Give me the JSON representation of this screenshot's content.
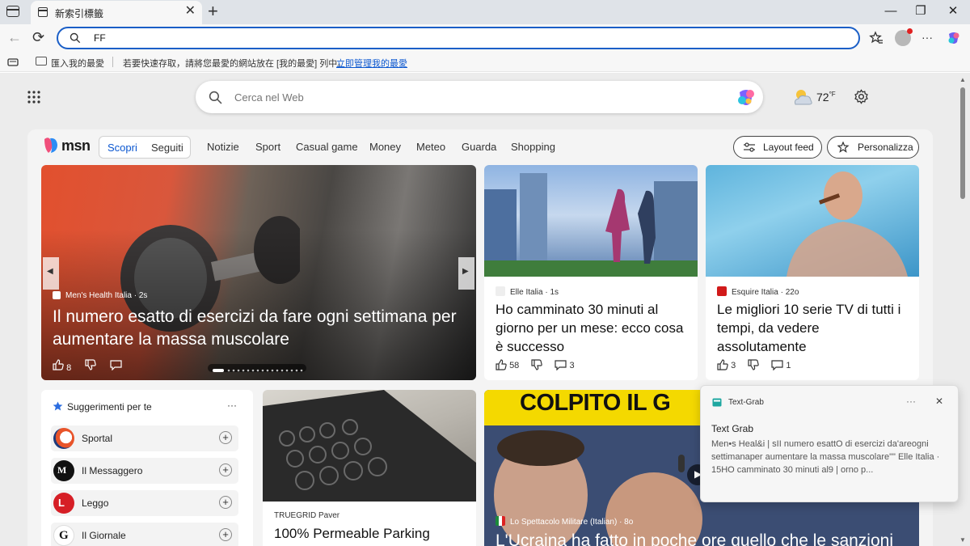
{
  "tab": {
    "title": "新索引標籤",
    "close": "✕",
    "new_tab": "+"
  },
  "window": {
    "minimize": "—",
    "maximize": "❐",
    "close": "✕"
  },
  "toolbar": {
    "back": "←",
    "reload": "⟳",
    "address_value": "FF",
    "more": "···"
  },
  "favorites_bar": {
    "import_label": "匯入我的最愛",
    "hint": "若要快速存取，請將您最愛的網站放在 [我的最愛] 列中。",
    "manage_link": "立即管理我的最愛"
  },
  "ntp": {
    "search_placeholder": "Cerca nel Web",
    "weather_temp": "72",
    "weather_unit": "°F"
  },
  "msn": {
    "logo": "msn",
    "segments": [
      "Scopri",
      "Seguiti"
    ],
    "nav": [
      "Notizie",
      "Sport",
      "Casual game",
      "Money",
      "Meteo",
      "Guarda",
      "Shopping"
    ],
    "layout_feed": "Layout feed",
    "personalize": "Personalizza"
  },
  "hero": {
    "source": "Men's Health Italia · 2s",
    "title": "Il numero esatto di esercizi da fare ogni settimana per aumentare la massa muscolare",
    "likes": "8"
  },
  "cards": [
    {
      "source": "Elle Italia · 1s",
      "title": "Ho camminato 30 minuti al giorno per un mese: ecco cosa è successo",
      "likes": "58",
      "comments": "3"
    },
    {
      "source": "Esquire Italia · 22o",
      "title": "Le migliori 10 serie TV di tutti i tempi, da vedere assolutamente",
      "likes": "3",
      "comments": "1"
    }
  ],
  "suggestions": {
    "title": "Suggerimenti per te",
    "more": "···",
    "items": [
      {
        "name": "Sportal",
        "add": "+"
      },
      {
        "name": "Il Messaggero",
        "add": "+"
      },
      {
        "name": "Leggo",
        "add": "+"
      },
      {
        "name": "Il Giornale",
        "add": "+"
      }
    ]
  },
  "card_paver": {
    "source": "TRUEGRID Paver",
    "title": "100% Permeable Parking"
  },
  "card_news": {
    "banner": "COLPITO IL G",
    "source": "Lo Spettacolo Militare (Italian) · 8o",
    "title": "L'Ucraina ha fatto in poche ore quello che le sanzioni"
  },
  "text_grab": {
    "app": "Text-Grab",
    "more": "···",
    "close": "✕",
    "heading": "Text Grab",
    "body": "Men•s Heal&i | sII numero esattO di esercizi da'areogni settimanaper aumentare la massa muscolare\"\" Elle Italia · 15HO camminato 30 minuti al9 | orno p..."
  },
  "colors": {
    "accent": "#0b57d0",
    "address_border": "#1b5fc7"
  }
}
